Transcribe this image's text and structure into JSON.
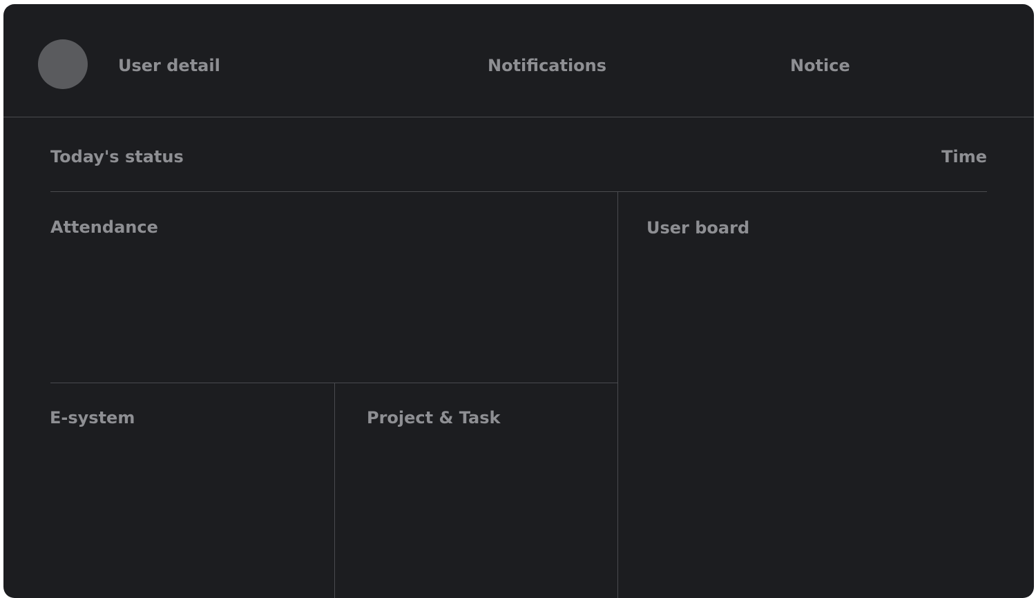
{
  "header": {
    "user_detail": "User detail",
    "notifications": "Notifications",
    "notice": "Notice"
  },
  "status_bar": {
    "todays_status": "Today's status",
    "time": "Time"
  },
  "panels": {
    "attendance": "Attendance",
    "user_board": "User board",
    "e_system": "E-system",
    "project_task": "Project & Task"
  },
  "colors": {
    "background": "#1c1d20",
    "text": "#8e8f93",
    "divider": "#4a4b4f",
    "avatar": "#5a5b5e"
  }
}
